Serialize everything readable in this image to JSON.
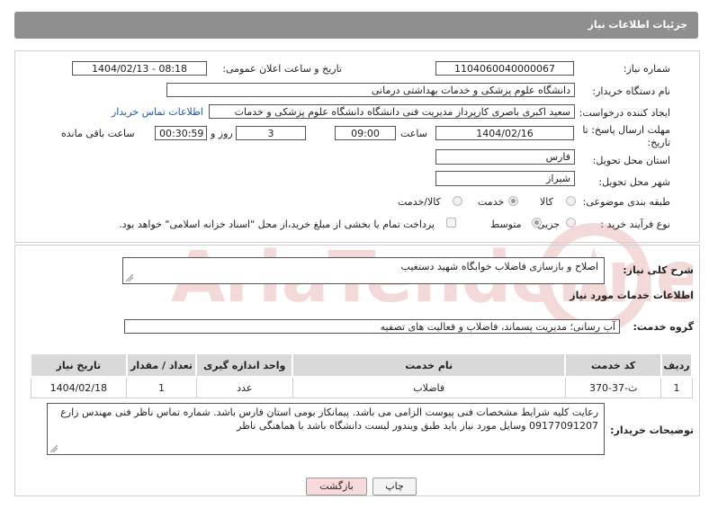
{
  "header": {
    "title": "جزئیات اطلاعات نیاز"
  },
  "form": {
    "need_number_label": "شماره نیاز:",
    "need_number": "1104060040000067",
    "announce_label": "تاریخ و ساعت اعلان عمومی:",
    "announce_value": "1404/02/13 - 08:18",
    "buyer_org_label": "نام دستگاه خریدار:",
    "buyer_org": "دانشگاه علوم پزشکی و خدمات بهداشتی درمانی",
    "creator_label": "ایجاد کننده درخواست:",
    "creator": "سعید اکبری باصری کارپرداز مدیریت فنی دانشگاه دانشگاه علوم پزشکی و خدمات",
    "contact_link": "اطلاعات تماس خریدار",
    "deadline_label_1": "مهلت ارسال پاسخ: تا",
    "deadline_label_2": "تاریخ:",
    "deadline_date": "1404/02/16",
    "time_label": "ساعت",
    "deadline_time": "09:00",
    "days_count": "3",
    "days_label": "روز و",
    "remaining_time": "00:30:59",
    "remaining_label": "ساعت باقی مانده",
    "province_label": "استان محل تحویل:",
    "province": "فارس",
    "city_label": "شهر محل تحویل:",
    "city": "شیراز",
    "category_label": "طبقه بندی موضوعی:",
    "category_options": [
      "کالا",
      "خدمت",
      "کالا/خدمت"
    ],
    "process_label": "نوع فرآیند خرید :",
    "process_options": [
      "جزیی",
      "متوسط"
    ],
    "payment_note": "پرداخت تمام یا بخشی از مبلغ خرید،از محل \"اسناد خزانه اسلامی\" خواهد بود."
  },
  "summary": {
    "label": "شرح کلی نیاز:",
    "text": "اصلاح و بازسازی فاضلاب خوابگاه شهید دستغیب"
  },
  "services": {
    "section_title": "اطلاعات خدمات مورد نیاز",
    "group_label": "گروه خدمت:",
    "group_value": "آب رسانی؛ مدیریت پسماند، فاضلاب و فعالیت های تصفیه",
    "columns": [
      "ردیف",
      "کد خدمت",
      "نام خدمت",
      "واحد اندازه گیری",
      "تعداد / مقدار",
      "تاریخ نیاز"
    ],
    "rows": [
      [
        "1",
        "ث-37-370",
        "فاضلاب",
        "عدد",
        "1",
        "1404/02/18"
      ]
    ]
  },
  "notes": {
    "label": "توضیحات خریدار:",
    "text": "رعایت کلیه شرایط مشخصات فنی پیوست الزامی می باشد. پیمانکار بومی استان فارس باشد. شماره تماس ناظر فنی مهندس زارع 09177091207 وسایل مورد نیاز باید طبق ویندور لیست دانشگاه باشد با هماهنگی ناظر"
  },
  "buttons": {
    "print": "چاپ",
    "back": "بازگشت"
  },
  "colors": {
    "header_bg": "#8f8f8f",
    "link": "#1a56c4",
    "back_button_bg": "#f9dada"
  }
}
